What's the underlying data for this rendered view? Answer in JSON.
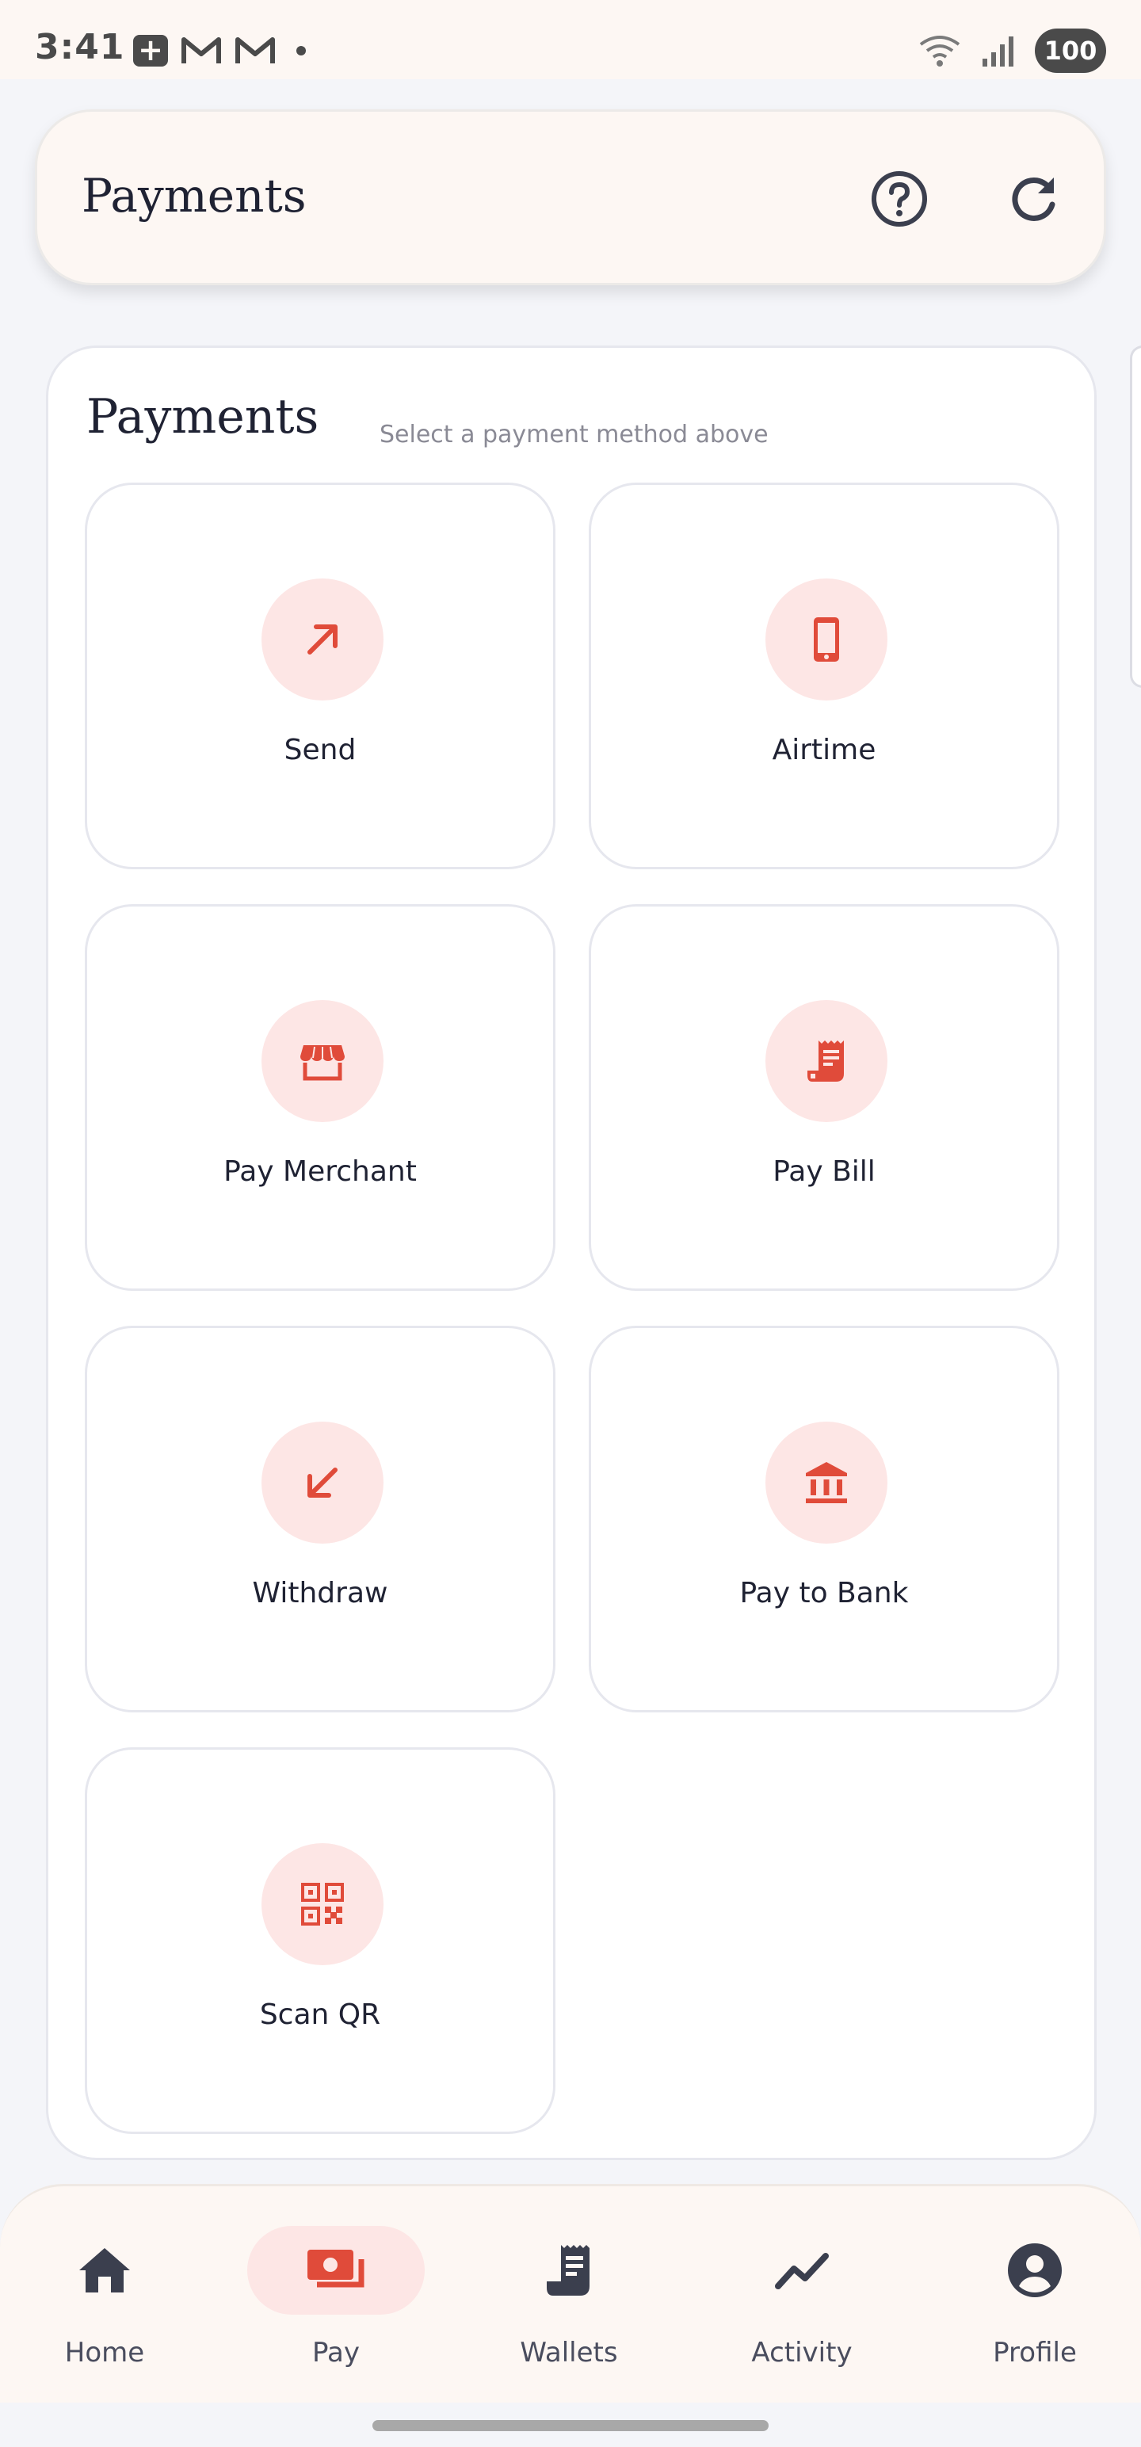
{
  "status_bar": {
    "time": "3:41",
    "battery": "100",
    "icons": [
      "plus-box-icon",
      "gmail-icon",
      "gmail-icon",
      "notification-dot-icon",
      "wifi-icon",
      "signal-icon"
    ]
  },
  "header": {
    "title": "Payments",
    "help_icon": "help-circle-icon",
    "refresh_icon": "refresh-icon"
  },
  "card": {
    "title": "Payments",
    "subtitle": "Select a payment method above"
  },
  "methods": [
    {
      "label": "Send",
      "icon": "arrow-up-right-icon"
    },
    {
      "label": "Airtime",
      "icon": "phone-icon"
    },
    {
      "label": "Pay Merchant",
      "icon": "storefront-icon"
    },
    {
      "label": "Pay Bill",
      "icon": "receipt-icon"
    },
    {
      "label": "Withdraw",
      "icon": "arrow-down-left-icon"
    },
    {
      "label": "Pay to Bank",
      "icon": "bank-icon"
    },
    {
      "label": "Scan QR",
      "icon": "qr-code-icon"
    }
  ],
  "nav": [
    {
      "label": "Home",
      "icon": "home-icon",
      "active": false
    },
    {
      "label": "Pay",
      "icon": "payments-icon",
      "active": true
    },
    {
      "label": "Wallets",
      "icon": "receipt-long-icon",
      "active": false
    },
    {
      "label": "Activity",
      "icon": "trend-icon",
      "active": false
    },
    {
      "label": "Profile",
      "icon": "account-circle-icon",
      "active": false
    }
  ],
  "colors": {
    "accent": "#e04b3a",
    "accent_bg": "#fde6e5",
    "surface": "#fdf7f3",
    "text": "#1f2233"
  }
}
